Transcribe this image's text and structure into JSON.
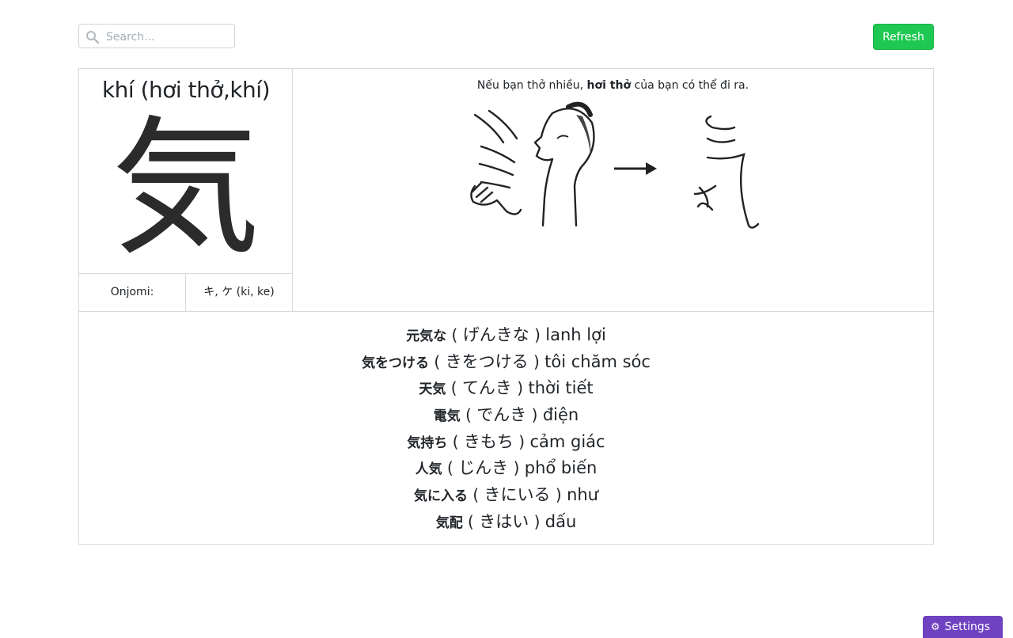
{
  "search": {
    "placeholder": "Search...",
    "value": ""
  },
  "refresh_label": "Refresh",
  "kanji_card": {
    "meaning": "khí (hơi thở,khí)",
    "character": "気",
    "readings": [
      {
        "label": "Onjomi:",
        "value": "キ, ケ (ki, ke)"
      }
    ],
    "mnemonic": {
      "before": "Nếu bạn thở nhiều, ",
      "bold": "hơi thở",
      "after": " của bạn có thể đi ra."
    }
  },
  "vocabulary": [
    {
      "word": "元気な",
      "kana": "げんきな",
      "meaning": "lanh lợi"
    },
    {
      "word": "気をつける",
      "kana": "きをつける",
      "meaning": "tôi chăm sóc"
    },
    {
      "word": "天気",
      "kana": "てんき",
      "meaning": "thời tiết"
    },
    {
      "word": "電気",
      "kana": "でんき",
      "meaning": "điện"
    },
    {
      "word": "気持ち",
      "kana": "きもち",
      "meaning": "cảm giác"
    },
    {
      "word": "人気",
      "kana": "じんき",
      "meaning": "phổ biến"
    },
    {
      "word": "気に入る",
      "kana": "きにいる",
      "meaning": "như"
    },
    {
      "word": "気配",
      "kana": "きはい",
      "meaning": "dấu"
    }
  ],
  "settings_label": "Settings",
  "icons": {
    "search": "search-icon",
    "settings": "gear-icon",
    "arrow": "arrow-right-icon"
  }
}
